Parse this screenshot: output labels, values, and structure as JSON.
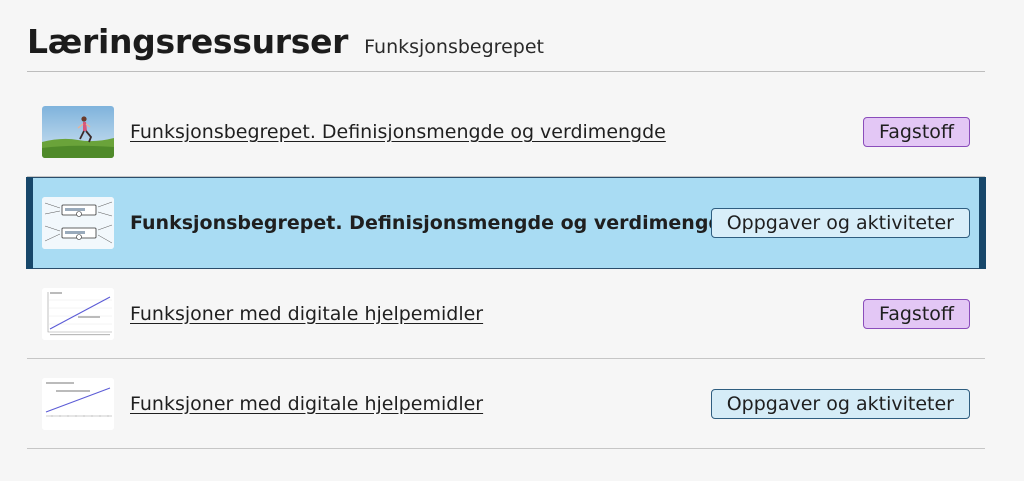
{
  "header": {
    "title": "Læringsressurser",
    "subtitle": "Funksjonsbegrepet"
  },
  "resources": [
    {
      "title": "Funksjonsbegrepet. Definisjonsmengde og verdimengde",
      "badge": "Fagstoff",
      "thumbnail": "runner-photo",
      "active": false
    },
    {
      "title": "Funksjonsbegrepet. Definisjonsmengde og verdimengde",
      "badge": "Oppgaver og aktiviteter",
      "thumbnail": "function-machine-diagram",
      "active": true
    },
    {
      "title": "Funksjoner med digitale hjelpemidler",
      "badge": "Fagstoff",
      "thumbnail": "line-graph",
      "active": false
    },
    {
      "title": "Funksjoner med digitale hjelpemidler",
      "badge": "Oppgaver og aktiviteter",
      "thumbnail": "line-graph",
      "active": false
    }
  ],
  "colors": {
    "active_bg": "#a9dcf3",
    "active_edge": "#17476a",
    "fagstoff_badge": "#e3c7f5",
    "oppgaver_badge": "#d5ecf7"
  }
}
